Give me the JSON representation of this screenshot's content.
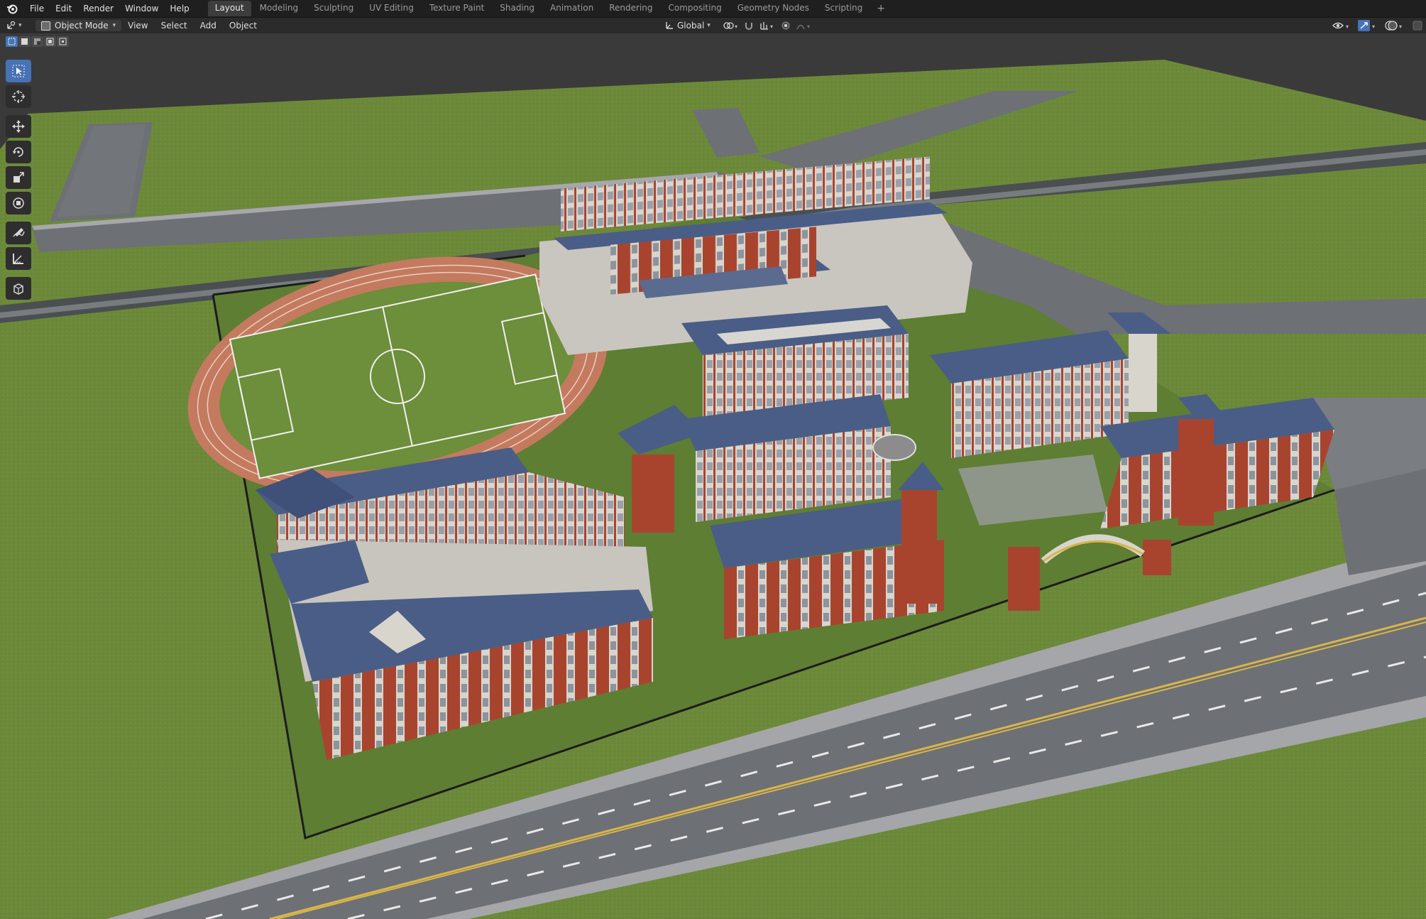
{
  "app": {
    "menu": [
      "File",
      "Edit",
      "Render",
      "Window",
      "Help"
    ]
  },
  "workspaces": {
    "tabs": [
      "Layout",
      "Modeling",
      "Sculpting",
      "UV Editing",
      "Texture Paint",
      "Shading",
      "Animation",
      "Rendering",
      "Compositing",
      "Geometry Nodes",
      "Scripting"
    ],
    "active": "Layout",
    "add_label": "+"
  },
  "viewport_header": {
    "mode": "Object Mode",
    "menus": [
      "View",
      "Select",
      "Add",
      "Object"
    ],
    "orientation": "Global"
  },
  "toolbar": {
    "tools": [
      "select-box",
      "cursor",
      "move",
      "rotate",
      "scale",
      "transform",
      "annotate",
      "measure",
      "add-cube"
    ],
    "active": "select-box"
  },
  "colors": {
    "accent": "#4772b3",
    "grass": "#6f8a3c",
    "road": "#6d7075",
    "brick": "#a8442e",
    "roof": "#4a5d86",
    "track": "#c47a5e"
  }
}
